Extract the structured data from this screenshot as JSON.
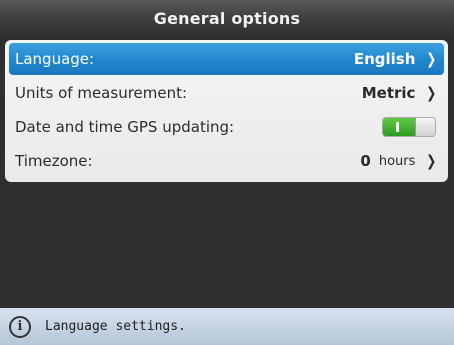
{
  "header": {
    "title": "General options"
  },
  "options": [
    {
      "label": "Language:",
      "value": "English",
      "selected": true
    },
    {
      "label": "Units of measurement:",
      "value": "Metric",
      "selected": false
    },
    {
      "label": "Date and time GPS updating:",
      "toggle_state": "on",
      "selected": false
    },
    {
      "label": "Timezone:",
      "value": "0",
      "unit": "hours",
      "selected": false
    }
  ],
  "icons": {
    "chevron": "chevron-right-icon",
    "info": "info-icon",
    "info_glyph": "i"
  },
  "status_bar": {
    "text": "Language settings."
  },
  "colors": {
    "selection": "#2388cf",
    "toggle_on": "#3fae2c",
    "title_bar": "#3c3c3c",
    "status_bar": "#c5d4e3"
  }
}
